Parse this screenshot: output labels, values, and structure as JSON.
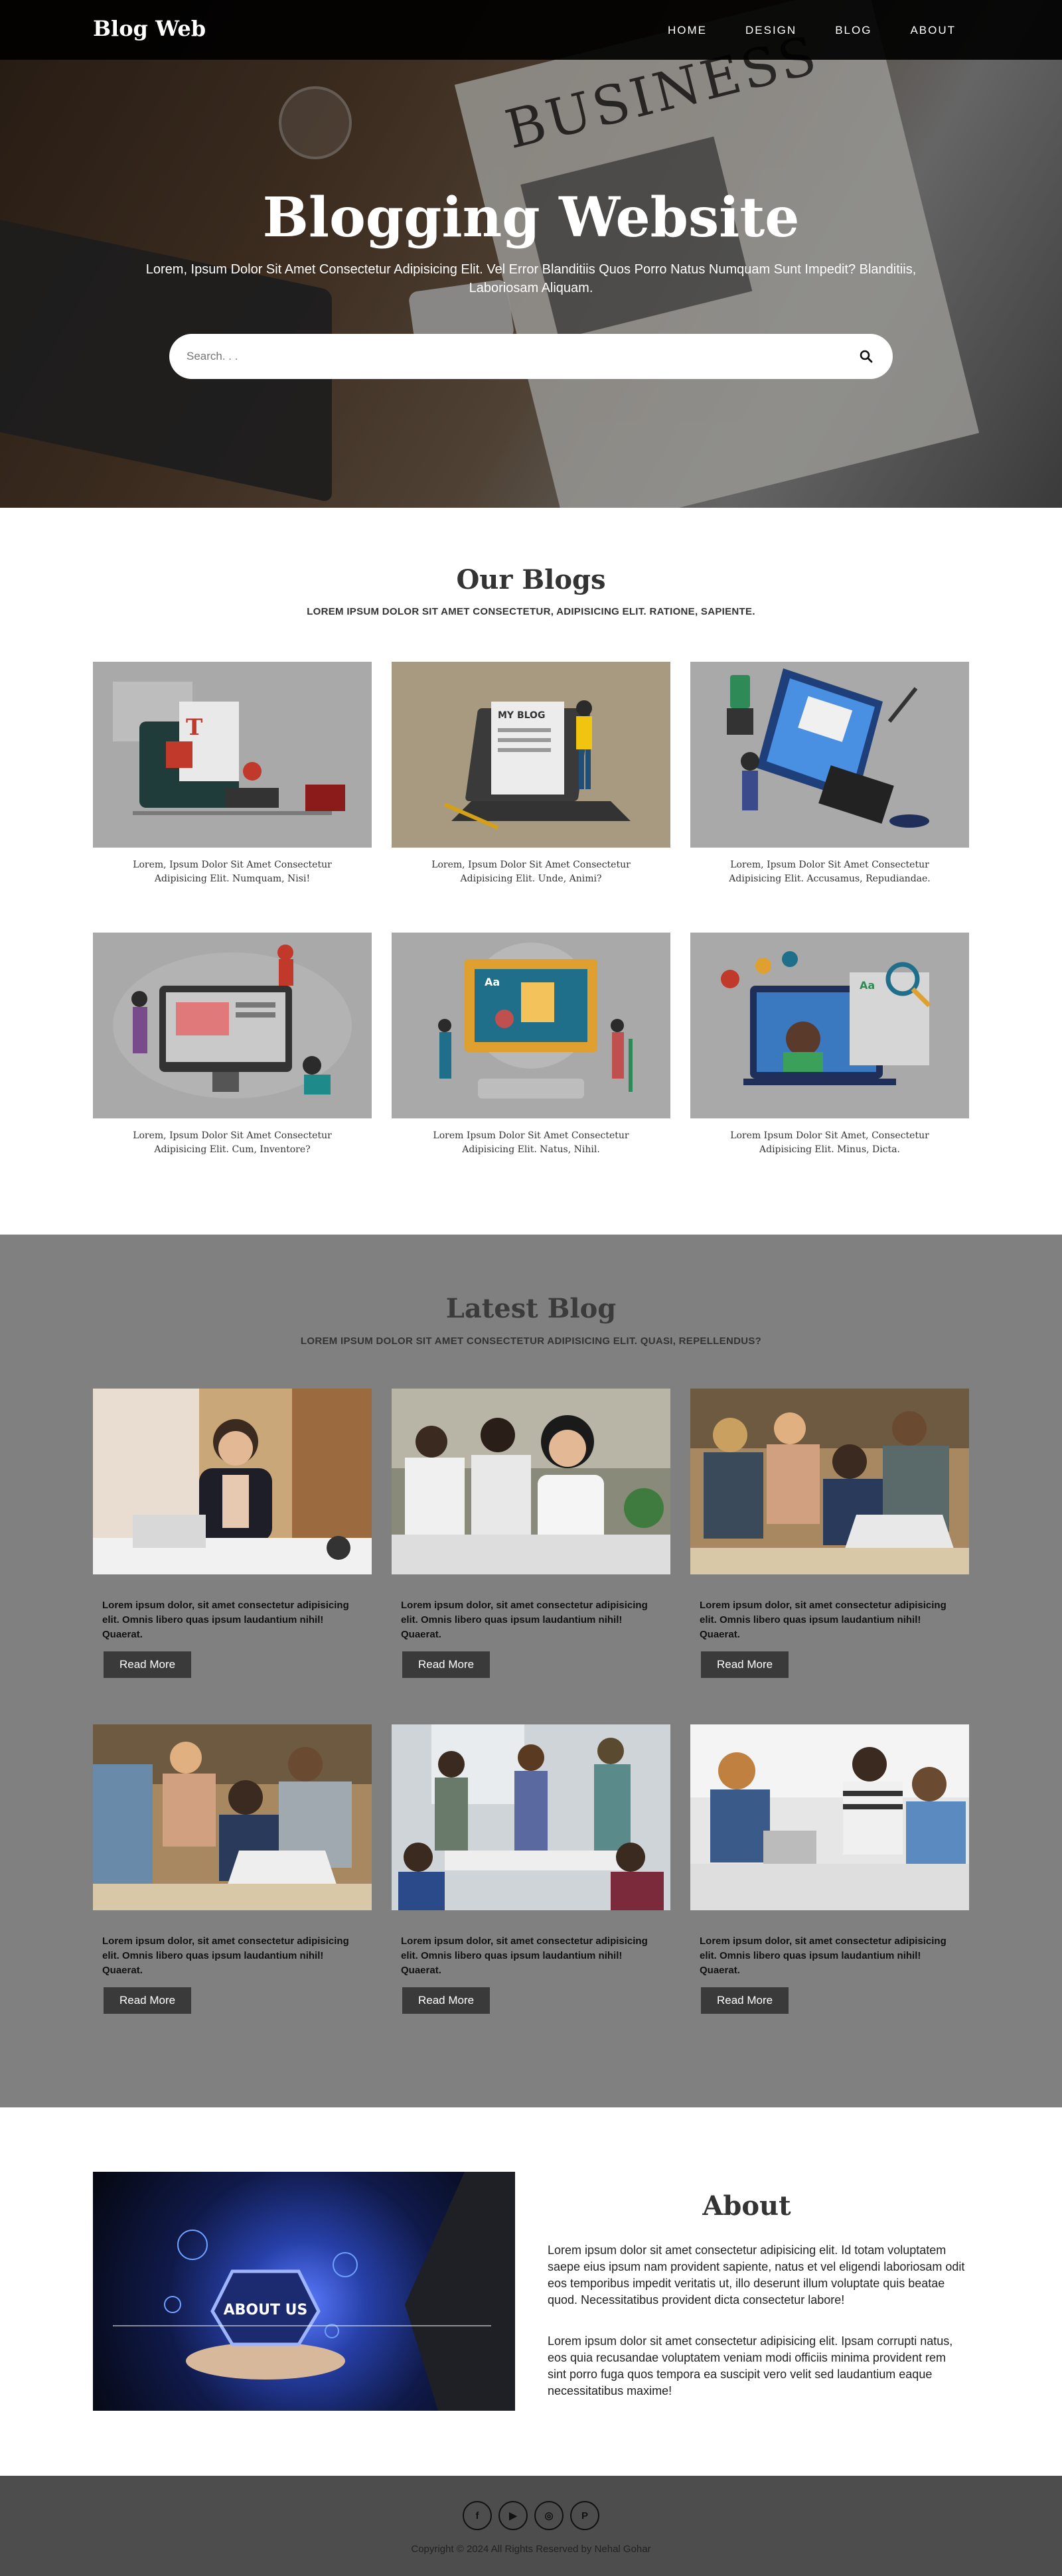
{
  "nav": {
    "brand": "Blog Web",
    "items": [
      "HOME",
      "DESIGN",
      "BLOG",
      "ABOUT"
    ]
  },
  "hero": {
    "title": "Blogging Website",
    "subtitle": "Lorem, Ipsum Dolor Sit Amet Consectetur Adipisicing Elit. Vel Error Blanditiis Quos Porro Natus Numquam Sunt Impedit? Blanditiis, Laboriosam Aliquam.",
    "newspaper_heading": "BUSINESS",
    "search_placeholder": "Search. . ."
  },
  "blogs": {
    "title": "Our Blogs",
    "subtitle": "LOREM IPSUM DOLOR SIT AMET CONSECTETUR, ADIPISICING ELIT. RATIONE, SAPIENTE.",
    "cards": [
      {
        "caption": "Lorem, Ipsum Dolor Sit Amet Consectetur Adipisicing Elit. Numquam, Nisi!",
        "bg": "#a9a9a9"
      },
      {
        "caption": "Lorem, Ipsum Dolor Sit Amet Consectetur Adipisicing Elit. Unde, Animi?",
        "bg": "#a89a80"
      },
      {
        "caption": "Lorem, Ipsum Dolor Sit Amet Consectetur Adipisicing Elit. Accusamus, Repudiandae.",
        "bg": "#a9a9a9"
      },
      {
        "caption": "Lorem, Ipsum Dolor Sit Amet Consectetur Adipisicing Elit. Cum, Inventore?",
        "bg": "#a9a9a9"
      },
      {
        "caption": "Lorem Ipsum Dolor Sit Amet Consectetur Adipisicing Elit. Natus, Nihil.",
        "bg": "#a9a9a9"
      },
      {
        "caption": "Lorem Ipsum Dolor Sit Amet, Consectetur Adipisicing Elit. Minus, Dicta.",
        "bg": "#a9a9a9"
      }
    ]
  },
  "latest": {
    "title": "Latest Blog",
    "subtitle": "LOREM IPSUM DOLOR SIT AMET CONSECTETUR ADIPISICING ELIT. QUASI, REPELLENDUS?",
    "cards": [
      {
        "text": "Lorem ipsum dolor, sit amet consectetur adipisicing elit. Omnis libero quas ipsum laudantium nihil! Quaerat.",
        "button": "Read More"
      },
      {
        "text": "Lorem ipsum dolor, sit amet consectetur adipisicing elit. Omnis libero quas ipsum laudantium nihil! Quaerat.",
        "button": "Read More"
      },
      {
        "text": "Lorem ipsum dolor, sit amet consectetur adipisicing elit. Omnis libero quas ipsum laudantium nihil! Quaerat.",
        "button": "Read More"
      },
      {
        "text": "Lorem ipsum dolor, sit amet consectetur adipisicing elit. Omnis libero quas ipsum laudantium nihil! Quaerat.",
        "button": "Read More"
      },
      {
        "text": "Lorem ipsum dolor, sit amet consectetur adipisicing elit. Omnis libero quas ipsum laudantium nihil! Quaerat.",
        "button": "Read More"
      },
      {
        "text": "Lorem ipsum dolor, sit amet consectetur adipisicing elit. Omnis libero quas ipsum laudantium nihil! Quaerat.",
        "button": "Read More"
      }
    ]
  },
  "about": {
    "title": "About",
    "image_label": "ABOUT US",
    "p1": "Lorem ipsum dolor sit amet consectetur adipisicing elit. Id totam voluptatem saepe eius ipsum nam provident sapiente, natus et vel eligendi laboriosam odit eos temporibus impedit veritatis ut, illo deserunt illum voluptate quis beatae quod. Necessitatibus provident dicta consectetur labore!",
    "p2": "Lorem ipsum dolor sit amet consectetur adipisicing elit. Ipsam corrupti natus, eos quia recusandae voluptatem veniam modi officiis minima provident rem sint porro fuga quos tempora ea suscipit vero velit sed laudantium eaque necessitatibus maxime!"
  },
  "footer": {
    "social_icons": [
      "facebook-icon",
      "youtube-icon",
      "instagram-icon",
      "pinterest-icon"
    ],
    "social_glyphs": [
      "f",
      "▶",
      "◎",
      "P"
    ],
    "copyright": "Copyright © 2024 All Rights Reserved by Nehal Gohar"
  },
  "colors": {
    "nav_bg": "#000000",
    "latest_bg": "#808080",
    "footer_bg": "#4d4d4d",
    "button_bg": "#3a3a3a"
  }
}
